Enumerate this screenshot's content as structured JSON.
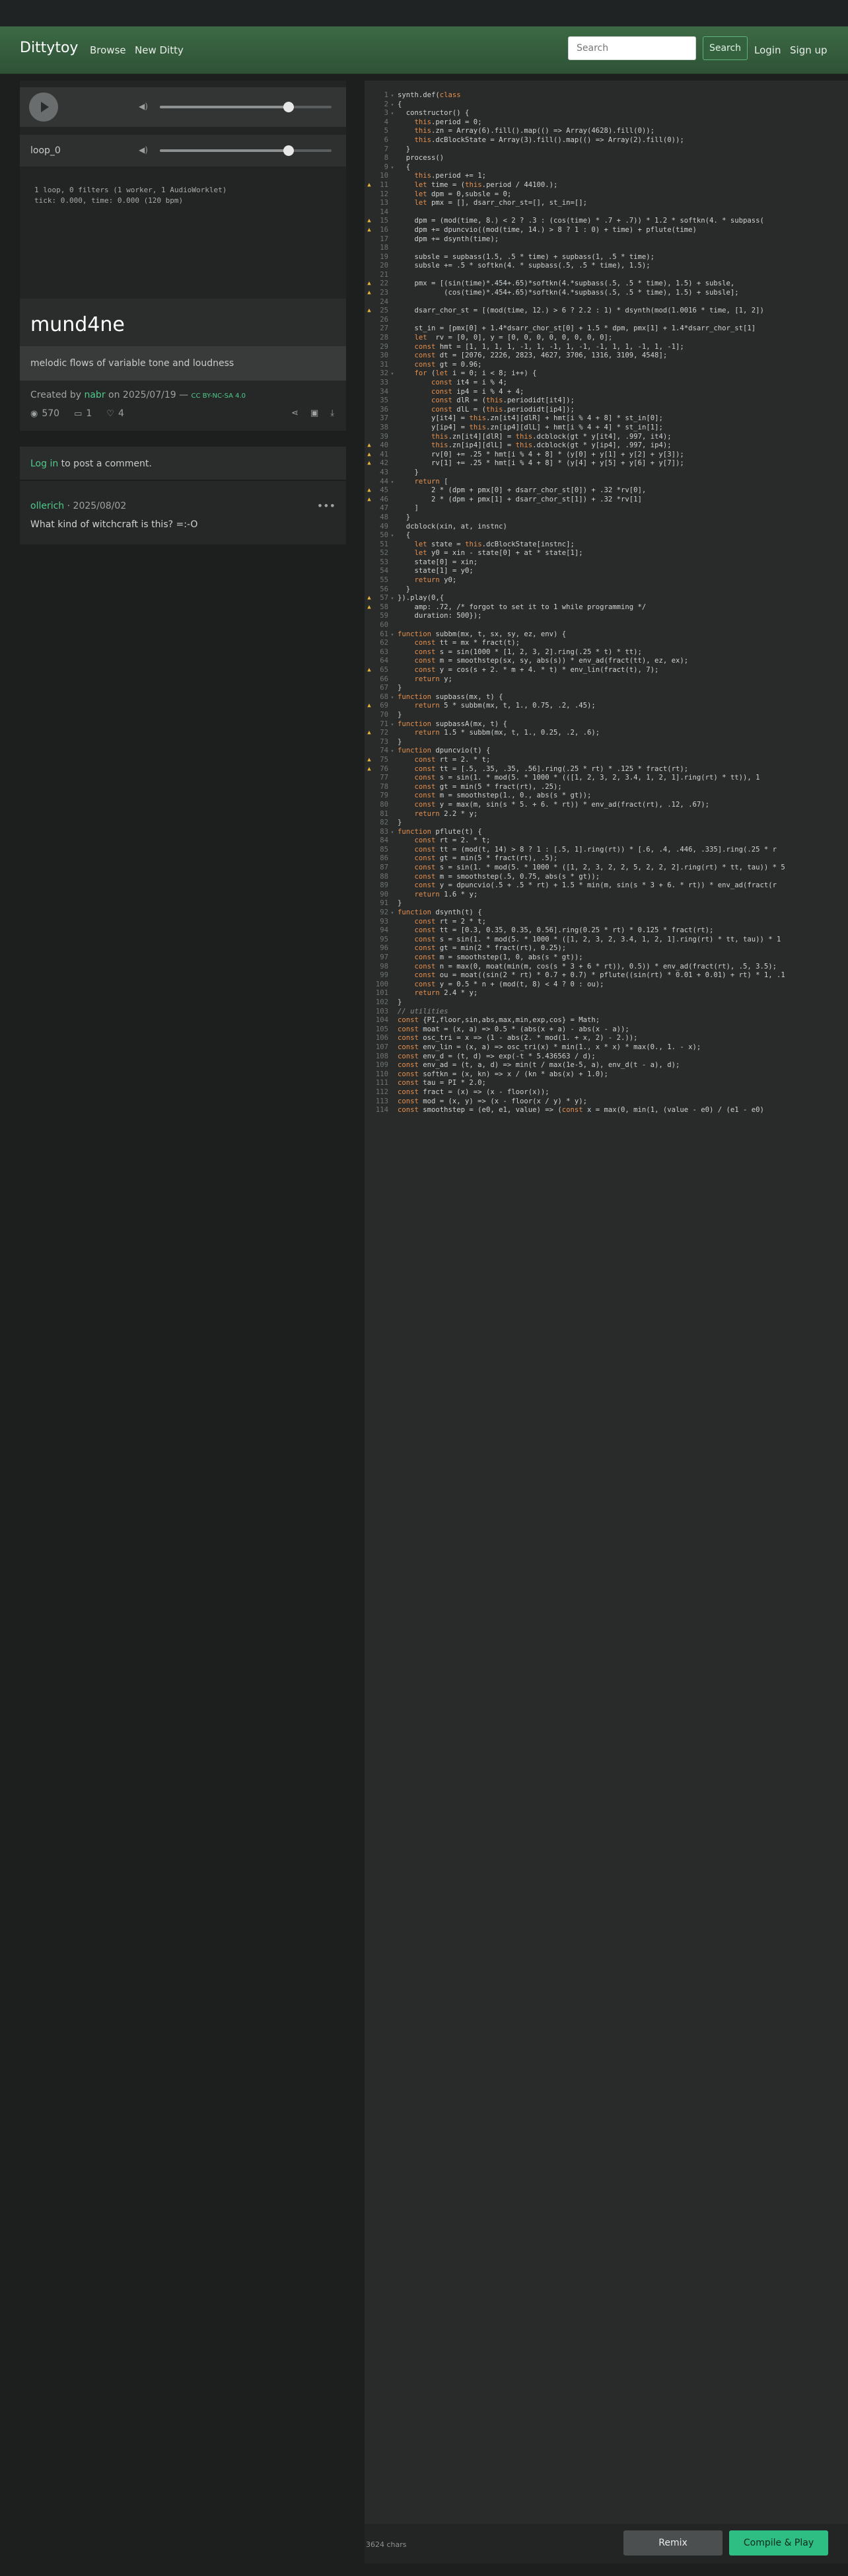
{
  "nav": {
    "brand": "Dittytoy",
    "links": [
      "Browse",
      "New Ditty"
    ],
    "search_placeholder": "Search",
    "search_button": "Search",
    "login": "Login",
    "signup": "Sign up"
  },
  "player": {
    "main_volume": 0.75,
    "loop_label": "loop_0",
    "loop_volume": 0.75,
    "stats_line1": "1 loop, 0 filters (1 worker, 1 AudioWorklet)",
    "stats_line2": "tick: 0.000, time: 0.000 (120 bpm)"
  },
  "ditty": {
    "title": "mund4ne",
    "description": "melodic flows of variable tone and loudness",
    "created_prefix": "Created by",
    "author": "nabr",
    "date": "on 2025/07/19 —",
    "license": "CC BY-NC-SA 4.0",
    "plays": "570",
    "comments": "1",
    "likes": "4"
  },
  "comments": {
    "login_link": "Log in",
    "login_rest": "to post a comment.",
    "items": [
      {
        "author": "ollerich",
        "date": "2025/08/02",
        "text": "What kind of witchcraft is this? =:-O"
      }
    ]
  },
  "editor": {
    "chars": "3624 chars",
    "lines": [
      {
        "n": "1",
        "f": "▾",
        "t": "synth.def(class"
      },
      {
        "n": "2",
        "f": "▾",
        "t": "{"
      },
      {
        "n": "3",
        "f": "▾",
        "t": "  constructor() {"
      },
      {
        "n": "4",
        "t": "    this.period = 0;"
      },
      {
        "n": "5",
        "t": "    this.zn = Array(6).fill().map(() => Array(4628).fill(0));"
      },
      {
        "n": "6",
        "t": "    this.dcBlockState = Array(3).fill().map(() => Array(2).fill(0));"
      },
      {
        "n": "7",
        "t": "  }"
      },
      {
        "n": "8",
        "t": "  process()"
      },
      {
        "n": "9",
        "f": "▾",
        "t": "  {"
      },
      {
        "n": "10",
        "t": "    this.period += 1;"
      },
      {
        "n": "11",
        "w": true,
        "t": "    let time = (this.period / 44100.);"
      },
      {
        "n": "12",
        "t": "    let dpm = 0,subsle = 0;"
      },
      {
        "n": "13",
        "t": "    let pmx = [], dsarr_chor_st=[], st_in=[];"
      },
      {
        "n": "14",
        "t": ""
      },
      {
        "n": "15",
        "w": true,
        "t": "    dpm = (mod(time, 8.) < 2 ? .3 : (cos(time) * .7 + .7)) * 1.2 * softkn(4. * subpass("
      },
      {
        "n": "16",
        "w": true,
        "t": "    dpm += dpuncvio((mod(time, 14.) > 8 ? 1 : 0) + time) + pflute(time)"
      },
      {
        "n": "17",
        "t": "    dpm += dsynth(time);"
      },
      {
        "n": "18",
        "t": ""
      },
      {
        "n": "19",
        "t": "    subsle = supbass(1.5, .5 * time) + supbass(1, .5 * time);"
      },
      {
        "n": "20",
        "t": "    subsle += .5 * softkn(4. * supbass(.5, .5 * time), 1.5);"
      },
      {
        "n": "21",
        "t": ""
      },
      {
        "n": "22",
        "w": true,
        "t": "    pmx = [(sin(time)*.454+.65)*softkn(4.*supbass(.5, .5 * time), 1.5) + subsle,"
      },
      {
        "n": "23",
        "w": true,
        "t": "           (cos(time)*.454+.65)*softkn(4.*supbass(.5, .5 * time), 1.5) + subsle];"
      },
      {
        "n": "24",
        "t": ""
      },
      {
        "n": "25",
        "w": true,
        "t": "    dsarr_chor_st = [(mod(time, 12.) > 6 ? 2.2 : 1) * dsynth(mod(1.0016 * time, [1, 2])"
      },
      {
        "n": "26",
        "t": ""
      },
      {
        "n": "27",
        "t": "    st_in = [pmx[0] + 1.4*dsarr_chor_st[0] + 1.5 * dpm, pmx[1] + 1.4*dsarr_chor_st[1]"
      },
      {
        "n": "28",
        "t": "    let  rv = [0, 0], y = [0, 0, 0, 0, 0, 0, 0, 0];"
      },
      {
        "n": "29",
        "t": "    const hmt = [1, 1, 1, 1, -1, 1, -1, 1, -1, -1, 1, 1, -1, 1, -1];"
      },
      {
        "n": "30",
        "t": "    const dt = [2076, 2226, 2823, 4627, 3706, 1316, 3109, 4548];"
      },
      {
        "n": "31",
        "t": "    const gt = 0.96;"
      },
      {
        "n": "32",
        "f": "▾",
        "t": "    for (let i = 0; i < 8; i++) {"
      },
      {
        "n": "33",
        "t": "        const it4 = i % 4;"
      },
      {
        "n": "34",
        "t": "        const ip4 = i % 4 + 4;"
      },
      {
        "n": "35",
        "t": "        const dlR = (this.periodidt[it4]);"
      },
      {
        "n": "36",
        "t": "        const dlL = (this.periodidt[ip4]);"
      },
      {
        "n": "37",
        "t": "        y[it4] = this.zn[it4][dlR] + hmt[i % 4 + 8] * st_in[0];"
      },
      {
        "n": "38",
        "t": "        y[ip4] = this.zn[ip4][dlL] + hmt[i % 4 + 4] * st_in[1];"
      },
      {
        "n": "39",
        "t": "        this.zn[it4][dlR] = this.dcblock(gt * y[it4], .997, it4);"
      },
      {
        "n": "40",
        "w": true,
        "t": "        this.zn[ip4][dlL] = this.dcblock(gt * y[ip4], .997, ip4);"
      },
      {
        "n": "41",
        "w": true,
        "t": "        rv[0] += .25 * hmt[i % 4 + 8] * (y[0] + y[1] + y[2] + y[3]);"
      },
      {
        "n": "42",
        "w": true,
        "t": "        rv[1] += .25 * hmt[i % 4 + 8] * (y[4] + y[5] + y[6] + y[7]);"
      },
      {
        "n": "43",
        "t": "    }"
      },
      {
        "n": "44",
        "f": "▾",
        "t": "    return ["
      },
      {
        "n": "45",
        "w": true,
        "t": "        2 * (dpm + pmx[0] + dsarr_chor_st[0]) + .32 *rv[0],"
      },
      {
        "n": "46",
        "w": true,
        "t": "        2 * (dpm + pmx[1] + dsarr_chor_st[1]) + .32 *rv[1]"
      },
      {
        "n": "47",
        "t": "    ]"
      },
      {
        "n": "48",
        "t": "  }"
      },
      {
        "n": "49",
        "t": "  dcblock(xin, at, instnc)"
      },
      {
        "n": "50",
        "f": "▾",
        "t": "  {"
      },
      {
        "n": "51",
        "t": "    let state = this.dcBlockState[instnc];"
      },
      {
        "n": "52",
        "t": "    let y0 = xin - state[0] + at * state[1];"
      },
      {
        "n": "53",
        "t": "    state[0] = xin;"
      },
      {
        "n": "54",
        "t": "    state[1] = y0;"
      },
      {
        "n": "55",
        "t": "    return y0;"
      },
      {
        "n": "56",
        "t": "  }"
      },
      {
        "n": "57",
        "w": true,
        "f": "▾",
        "t": "}).play(0,{"
      },
      {
        "n": "58",
        "w": true,
        "t": "    amp: .72, /* forgot to set it to 1 while programming */"
      },
      {
        "n": "59",
        "t": "    duration: 500});"
      },
      {
        "n": "60",
        "t": ""
      },
      {
        "n": "61",
        "f": "▾",
        "t": "function subbm(mx, t, sx, sy, ez, env) {"
      },
      {
        "n": "62",
        "t": "    const tt = mx * fract(t);"
      },
      {
        "n": "63",
        "t": "    const s = sin(1000 * [1, 2, 3, 2].ring(.25 * t) * tt);"
      },
      {
        "n": "64",
        "t": "    const m = smoothstep(sx, sy, abs(s)) * env_ad(fract(tt), ez, ex);"
      },
      {
        "n": "65",
        "w": true,
        "t": "    const y = cos(s + 2. * m + 4. * t) * env_lin(fract(t), 7);"
      },
      {
        "n": "66",
        "t": "    return y;"
      },
      {
        "n": "67",
        "t": "}"
      },
      {
        "n": "68",
        "f": "▾",
        "t": "function supbass(mx, t) {"
      },
      {
        "n": "69",
        "w": true,
        "t": "    return 5 * subbm(mx, t, 1., 0.75, .2, .45);"
      },
      {
        "n": "70",
        "t": "}"
      },
      {
        "n": "71",
        "f": "▾",
        "t": "function supbassA(mx, t) {"
      },
      {
        "n": "72",
        "w": true,
        "t": "    return 1.5 * subbm(mx, t, 1., 0.25, .2, .6);"
      },
      {
        "n": "73",
        "t": "}"
      },
      {
        "n": "74",
        "f": "▾",
        "t": "function dpuncvio(t) {"
      },
      {
        "n": "75",
        "w": true,
        "t": "    const rt = 2. * t;"
      },
      {
        "n": "76",
        "w": true,
        "t": "    const tt = [.5, .35, .35, .56].ring(.25 * rt) * .125 * fract(rt);"
      },
      {
        "n": "77",
        "t": "    const s = sin(1. * mod(5. * 1000 * (([1, 2, 3, 2, 3.4, 1, 2, 1].ring(rt) * tt)), 1"
      },
      {
        "n": "78",
        "t": "    const gt = min(5 * fract(rt), .25);"
      },
      {
        "n": "79",
        "t": "    const m = smoothstep(1., 0., abs(s * gt));"
      },
      {
        "n": "80",
        "t": "    const y = max(m, sin(s * 5. + 6. * rt)) * env_ad(fract(rt), .12, .67);"
      },
      {
        "n": "81",
        "t": "    return 2.2 * y;"
      },
      {
        "n": "82",
        "t": "}"
      },
      {
        "n": "83",
        "f": "▾",
        "t": "function pflute(t) {"
      },
      {
        "n": "84",
        "t": "    const rt = 2. * t;"
      },
      {
        "n": "85",
        "t": "    const tt = (mod(t, 14) > 8 ? 1 : [.5, 1].ring(rt)) * [.6, .4, .446, .335].ring(.25 * r"
      },
      {
        "n": "86",
        "t": "    const gt = min(5 * fract(rt), .5);"
      },
      {
        "n": "87",
        "t": "    const s = sin(1. * mod(5. * 1000 * ([1, 2, 3, 2, 2, 5, 2, 2, 2].ring(rt) * tt, tau)) * 5"
      },
      {
        "n": "88",
        "t": "    const m = smoothstep(.5, 0.75, abs(s * gt));"
      },
      {
        "n": "89",
        "t": "    const y = dpuncvio(.5 + .5 * rt) + 1.5 * min(m, sin(s * 3 + 6. * rt)) * env_ad(fract(r"
      },
      {
        "n": "90",
        "t": "    return 1.6 * y;"
      },
      {
        "n": "91",
        "t": "}"
      },
      {
        "n": "92",
        "f": "▾",
        "t": "function dsynth(t) {"
      },
      {
        "n": "93",
        "t": "    const rt = 2 * t;"
      },
      {
        "n": "94",
        "t": "    const tt = [0.3, 0.35, 0.35, 0.56].ring(0.25 * rt) * 0.125 * fract(rt);"
      },
      {
        "n": "95",
        "t": "    const s = sin(1. * mod(5. * 1000 * ([1, 2, 3, 2, 3.4, 1, 2, 1].ring(rt) * tt, tau)) * 1"
      },
      {
        "n": "96",
        "t": "    const gt = min(2 * fract(rt), 0.25);"
      },
      {
        "n": "97",
        "t": "    const m = smoothstep(1, 0, abs(s * gt));"
      },
      {
        "n": "98",
        "t": "    const n = max(0, moat(min(m, cos(s * 3 + 6 * rt)), 0.5)) * env_ad(fract(rt), .5, 3.5);"
      },
      {
        "n": "99",
        "t": "    const ou = moat((sin(2 * rt) * 0.7 + 0.7) * pflute((sin(rt) * 0.01 + 0.01) + rt) * 1, .1"
      },
      {
        "n": "100",
        "t": "    const y = 0.5 * n + (mod(t, 8) < 4 ? 0 : ou);"
      },
      {
        "n": "101",
        "t": "    return 2.4 * y;"
      },
      {
        "n": "102",
        "t": "}"
      },
      {
        "n": "103",
        "c": true,
        "t": "// utilities"
      },
      {
        "n": "104",
        "t": "const {PI,floor,sin,abs,max,min,exp,cos} = Math;"
      },
      {
        "n": "105",
        "t": "const moat = (x, a) => 0.5 * (abs(x + a) - abs(x - a));"
      },
      {
        "n": "106",
        "t": "const osc_tri = x => (1 - abs(2. * mod(1. + x, 2) - 2.));"
      },
      {
        "n": "107",
        "t": "const env_lin = (x, a) => osc_tri(x) * min(1., x * x) * max(0., 1. - x);"
      },
      {
        "n": "108",
        "t": "const env_d = (t, d) => exp(-t * 5.436563 / d);"
      },
      {
        "n": "109",
        "t": "const env_ad = (t, a, d) => min(t / max(1e-5, a), env_d(t - a), d);"
      },
      {
        "n": "110",
        "t": "const softkn = (x, kn) => x / (kn * abs(x) + 1.0);"
      },
      {
        "n": "111",
        "t": "const tau = PI * 2.0;"
      },
      {
        "n": "112",
        "t": "const fract = (x) => (x - floor(x));"
      },
      {
        "n": "113",
        "t": "const mod = (x, y) => (x - floor(x / y) * y);"
      },
      {
        "n": "114",
        "t": "const smoothstep = (e0, e1, value) => (const x = max(0, min(1, (value - e0) / (e1 - e0)"
      }
    ]
  },
  "bottom": {
    "remix": "Remix",
    "compile_play": "Compile & Play"
  },
  "colors": {
    "accent": "#4fca8a",
    "compile_button": "#2ebd83",
    "navbar": "#3c6a44",
    "warning": "#e6b33a",
    "keyword": "#e58f4c"
  }
}
